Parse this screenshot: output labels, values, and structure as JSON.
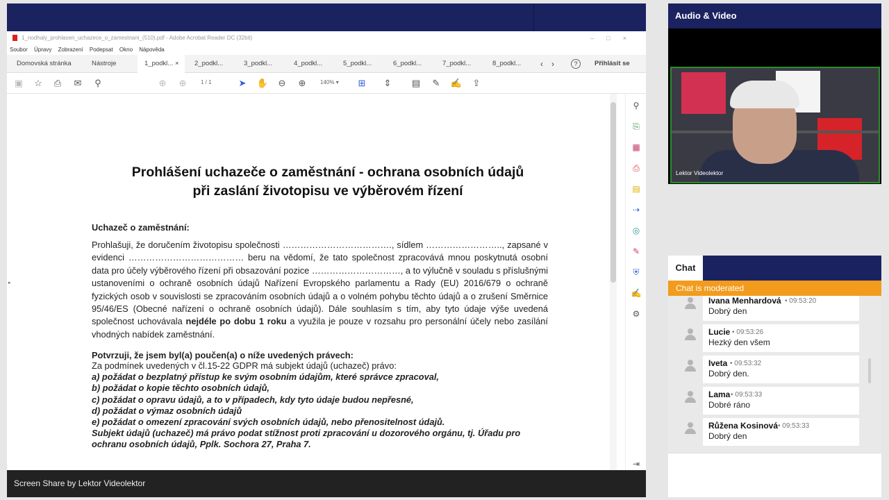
{
  "share": {
    "window_title": "1_nodhaly_prohlasen_uchazece_o_zamestnani_(510).pdf - Adobe Acrobat Reader DC (32bit)",
    "menu": [
      "Soubor",
      "Úpravy",
      "Zobrazení",
      "Podepsat",
      "Okno",
      "Nápověda"
    ],
    "tabs": {
      "home": "Domovská stránka",
      "tools": "Nástroje",
      "doc1": "1_podkl...",
      "doc2": "2_podkl...",
      "doc3": "3_podkl...",
      "doc4": "4_podkl...",
      "doc5": "5_podkl...",
      "doc6": "6_podkl...",
      "doc7": "7_podkl...",
      "doc8": "8_podkl...",
      "signin": "Přihlásit se",
      "close": "×",
      "help": "?"
    },
    "pager": "1   / 1",
    "zoom": "140%",
    "caption": "Screen Share by Lektor Videolektor"
  },
  "doc": {
    "title_line1": "Prohlášení uchazeče o zaměstnání - ochrana osobních údajů",
    "title_line2": "při zaslání životopisu ve výběrovém řízení",
    "applicant_heading": "Uchazeč o zaměstnání:",
    "p1": "Prohlašuji, že doručením životopisu společnosti ………………………………., sídlem …………………….., zapsané v evidenci …………………………………  beru na vědomí, že tato společnost zpracovává mnou poskytnutá osobní data  pro účely výběrového řízení při obsazování pozice …………………………, a to výlučně v souladu s   příslušnými ustanoveními o ochraně osobních údajů Nařízení Evropského parlamentu a Rady (EU) 2016/679 o ochraně fyzických osob v souvislosti se zpracováním osobních údajů a o volném pohybu těchto údajů a o zrušení Směrnice 95/46/ES (Obecné nařízení o ochraně osobních údajů). Dále souhlasím s tím, aby tyto údaje výše uvedená společnost uchovávala",
    "p1_bold": "nejdéle po dobu 1 roku",
    "p1_end": "a využila je pouze v rozsahu pro personální účely nebo zasílání vhodných nabídek zaměstnání.",
    "rights_heading": "Potvrzuji, že jsem byl(a) poučen(a) o níže uvedených právech:",
    "rights_intro": "Za podmínek uvedených v čl.15-22 GDPR má subjekt údajů (uchazeč) právo:",
    "rights": [
      "a) požádat o bezplatný přístup ke svým osobním údajům, které správce zpracoval,",
      "b) požádat o kopie těchto osobních údajů,",
      "c) požádat o opravu údajů, a to v případech, kdy tyto údaje budou nepřesné,",
      "d) požádat o výmaz osobních údajů",
      "e) požádat o omezení zpracování svých osobních údajů, nebo přenositelnost údajů.",
      "Subjekt údajů (uchazeč) má právo podat stížnost proti zpracování u dozorového orgánu, tj. Úřadu pro ochranu osobních údajů, Pplk. Sochora 27, Praha 7."
    ]
  },
  "av": {
    "title": "Audio & Video",
    "video_label": "Lektor Videolektor"
  },
  "chat": {
    "tab": "Chat",
    "moderated": "Chat is moderated",
    "messages": [
      {
        "name": "Ivana Menhardová",
        "time": "09:53:20",
        "text": "Dobrý den"
      },
      {
        "name": "Lucie",
        "time": "09:53:26",
        "text": "Hezký den všem"
      },
      {
        "name": "Iveta",
        "time": "09:53:32",
        "text": "Dobrý den."
      },
      {
        "name": "Lama",
        "time": "09:53:33",
        "text": "Dobré ráno"
      },
      {
        "name": "Růžena Kosinová",
        "time": "09:53:33",
        "text": "Dobrý den"
      }
    ]
  },
  "colors": {
    "header_navy": "#1b2260",
    "moderated_orange": "#f29b1d",
    "video_border_green": "#2e8b2e"
  },
  "icons": {
    "toolbar": [
      "save-icon",
      "star-icon",
      "print-icon",
      "mail-icon",
      "search-icon",
      "cursor-icon",
      "hand-icon",
      "zoom-out-icon",
      "zoom-in-icon",
      "fit-page-icon",
      "scroll-mode-icon",
      "comment-icon",
      "pen-icon",
      "sign-icon",
      "share-icon"
    ],
    "right_tools": [
      "zoom-icon",
      "export-pdf-icon",
      "organize-pages-icon",
      "create-pdf-icon",
      "comment-icon",
      "send-icon",
      "scan-icon",
      "edit-pdf-icon",
      "protect-icon",
      "fill-sign-icon",
      "more-tools-icon",
      "expand-icon"
    ]
  }
}
